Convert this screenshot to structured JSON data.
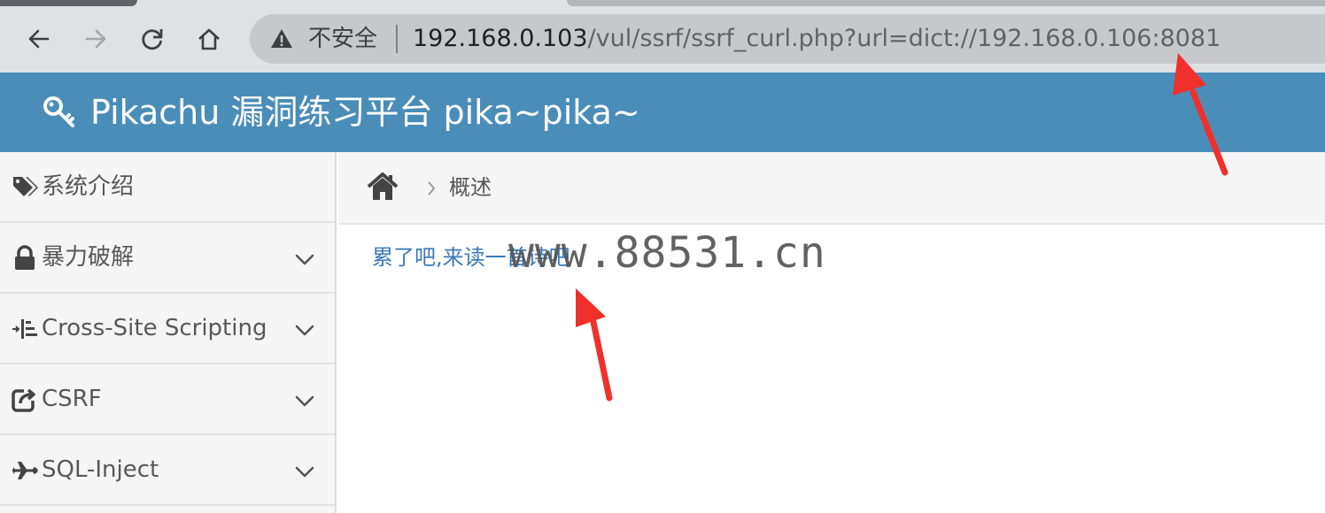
{
  "browser": {
    "security_label": "不安全",
    "url_host": "192.168.0.103",
    "url_path": "/vul/ssrf/ssrf_curl.php?url=dict://192.168.0.106:8081",
    "icons": [
      "back-icon",
      "forward-icon",
      "reload-icon",
      "home-icon",
      "warning-icon"
    ]
  },
  "site": {
    "title": "Pikachu 漏洞练习平台 pika~pika~",
    "header_color": "#4a8db9"
  },
  "sidebar": {
    "items": [
      {
        "label": "系统介绍",
        "icon": "tags-icon",
        "expandable": false
      },
      {
        "label": "暴力破解",
        "icon": "lock-icon",
        "expandable": true
      },
      {
        "label": "Cross-Site Scripting",
        "icon": "indent-icon",
        "expandable": true
      },
      {
        "label": "CSRF",
        "icon": "share-icon",
        "expandable": true
      },
      {
        "label": "SQL-Inject",
        "icon": "plane-icon",
        "expandable": true
      }
    ]
  },
  "breadcrumb": {
    "current": "概述"
  },
  "main": {
    "link_text": "累了吧,来读一首诗吧"
  },
  "watermark": "www.88531.cn",
  "annotation_color": "#f0302a"
}
